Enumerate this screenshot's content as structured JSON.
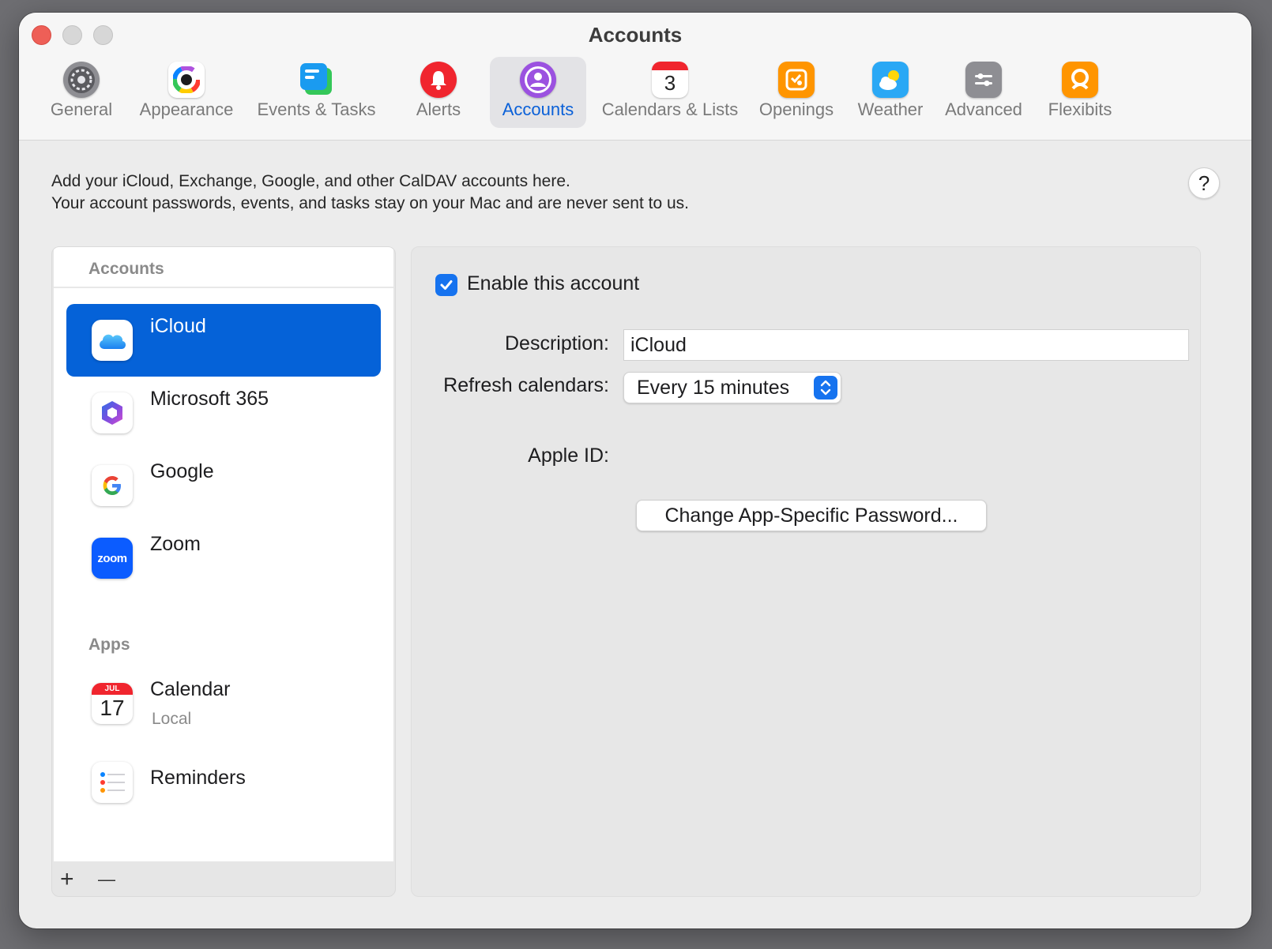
{
  "window": {
    "title": "Accounts"
  },
  "tabs": [
    {
      "label": "General",
      "icon": "gear-icon"
    },
    {
      "label": "Appearance",
      "icon": "color-wheel-icon"
    },
    {
      "label": "Events & Tasks",
      "icon": "events-tasks-icon"
    },
    {
      "label": "Alerts",
      "icon": "bell-icon"
    },
    {
      "label": "Accounts",
      "icon": "person-icon",
      "active": true
    },
    {
      "label": "Calendars & Lists",
      "icon": "calendar-icon",
      "badge": "3"
    },
    {
      "label": "Openings",
      "icon": "openings-icon"
    },
    {
      "label": "Weather",
      "icon": "weather-icon"
    },
    {
      "label": "Advanced",
      "icon": "sliders-icon"
    },
    {
      "label": "Flexibits",
      "icon": "flexibits-icon"
    }
  ],
  "intro": {
    "line1": "Add your iCloud, Exchange, Google, and other CalDAV accounts here.",
    "line2": "Your account passwords, events, and tasks stay on your Mac and are never sent to us."
  },
  "help": {
    "label": "?"
  },
  "sidebar": {
    "accounts_header": "Accounts",
    "accounts": [
      {
        "name": "iCloud",
        "icon": "icloud-icon",
        "selected": true
      },
      {
        "name": "Microsoft 365",
        "icon": "microsoft-365-icon"
      },
      {
        "name": "Google",
        "icon": "google-icon"
      },
      {
        "name": "Zoom",
        "icon": "zoom-icon",
        "icon_text": "zoom"
      }
    ],
    "apps_header": "Apps",
    "apps": [
      {
        "name": "Calendar",
        "sub": "Local",
        "icon": "calendar-app-icon",
        "month": "JUL",
        "day": "17"
      },
      {
        "name": "Reminders",
        "icon": "reminders-icon"
      }
    ],
    "add_label": "+",
    "remove_label": "—"
  },
  "detail": {
    "enable_label": "Enable this account",
    "enabled": true,
    "description_label": "Description:",
    "description_value": "iCloud",
    "refresh_label": "Refresh calendars:",
    "refresh_value": "Every 15 minutes",
    "apple_id_label": "Apple ID:",
    "change_password_button": "Change App-Specific Password..."
  },
  "colors": {
    "accent": "#0562d8",
    "active_tab_label": "#0a60d8",
    "checkbox": "#1673ef"
  }
}
